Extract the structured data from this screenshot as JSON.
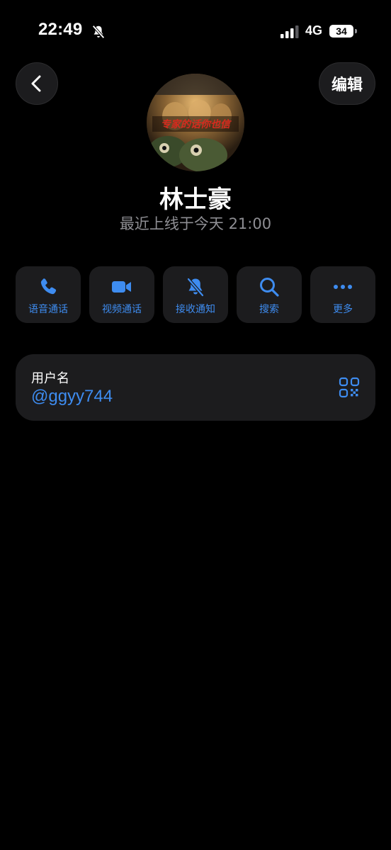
{
  "status_bar": {
    "time": "22:49",
    "network": "4G",
    "battery": "34"
  },
  "header": {
    "edit_label": "编辑"
  },
  "profile": {
    "name": "林士豪",
    "last_seen": "最近上线于今天 21:00",
    "avatar_caption": "专家的话你也信"
  },
  "actions": [
    {
      "label": "语音通话",
      "icon": "phone-icon"
    },
    {
      "label": "视频通话",
      "icon": "video-camera-icon"
    },
    {
      "label": "接收通知",
      "icon": "bell-slash-icon"
    },
    {
      "label": "搜索",
      "icon": "search-icon"
    },
    {
      "label": "更多",
      "icon": "more-dots-icon"
    }
  ],
  "username_card": {
    "title": "用户名",
    "value": "@ggyy744",
    "qr_icon": "qr-code-icon"
  },
  "colors": {
    "accent": "#3e8cf0",
    "card_bg": "#1c1c1e",
    "secondary_text": "#8e8e93"
  }
}
